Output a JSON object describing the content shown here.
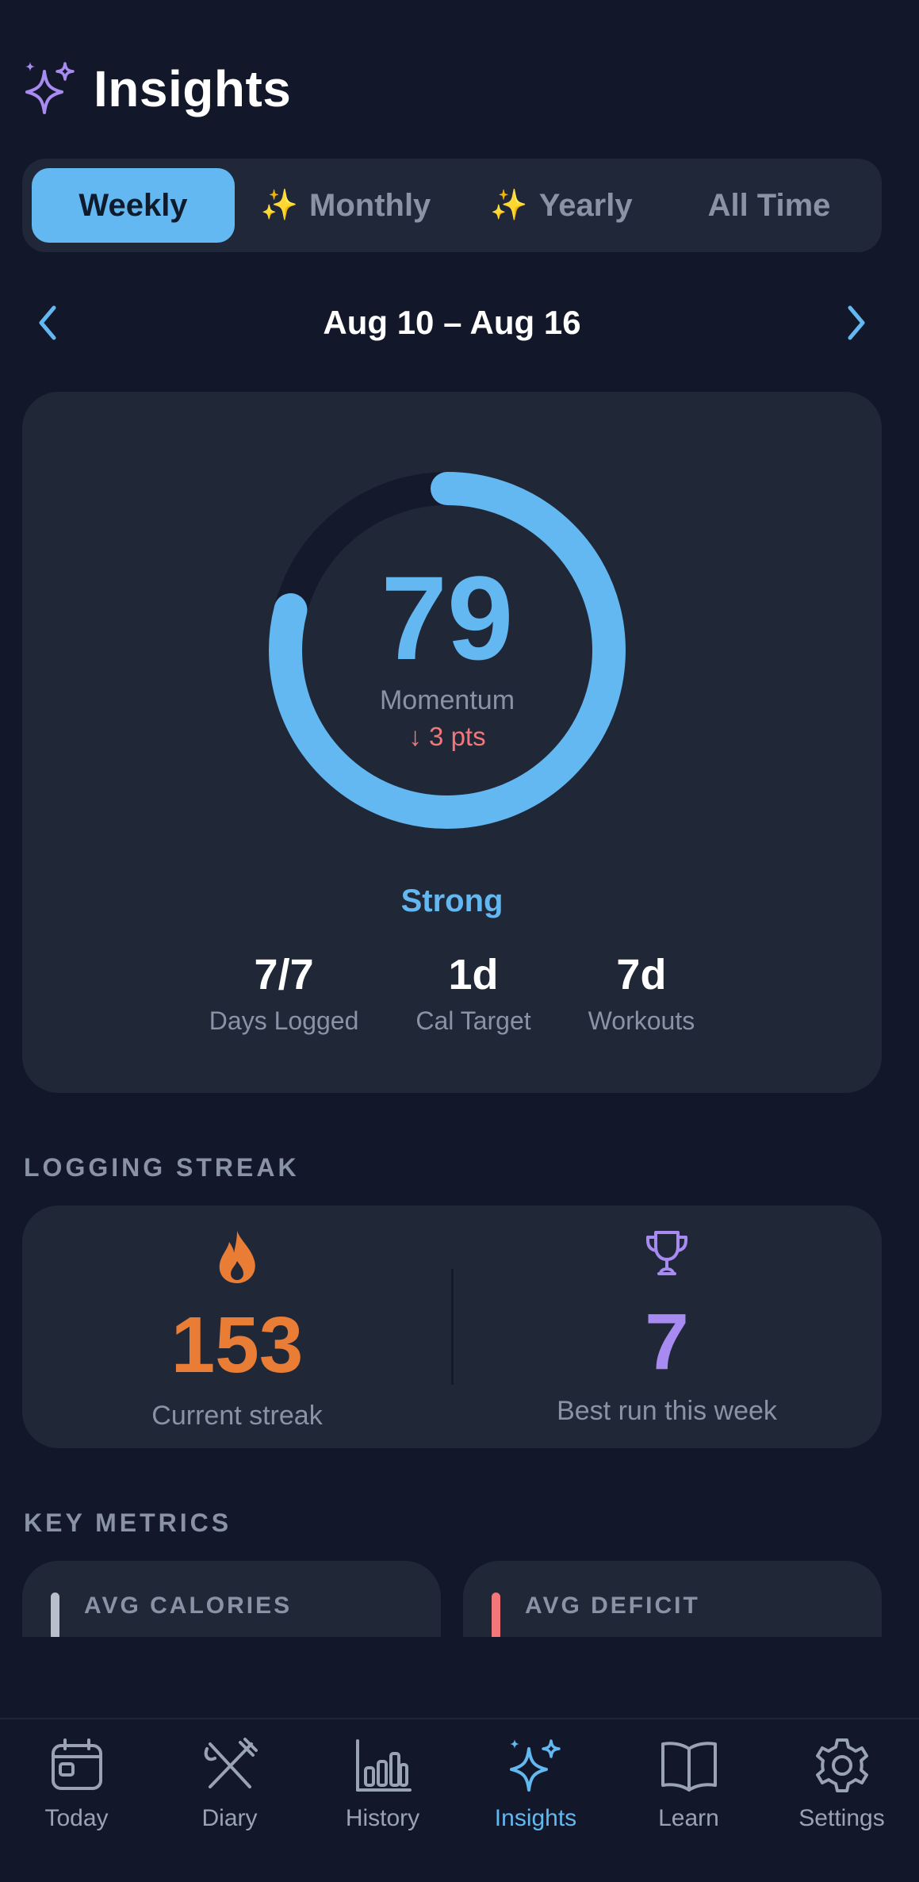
{
  "header": {
    "title": "Insights",
    "icon": "sparkles-icon"
  },
  "period_tabs": [
    {
      "label": "Weekly",
      "active": true,
      "premium": false
    },
    {
      "label": "Monthly",
      "active": false,
      "premium": true
    },
    {
      "label": "Yearly",
      "active": false,
      "premium": true
    },
    {
      "label": "All Time",
      "active": false,
      "premium": false
    }
  ],
  "premium_glyph": "✨",
  "date_nav": {
    "range": "Aug 10 – Aug 16",
    "prev_icon": "chevron-left-icon",
    "next_icon": "chevron-right-icon"
  },
  "momentum": {
    "score": "79",
    "score_value": 79,
    "score_max": 100,
    "label": "Momentum",
    "delta": "↓ 3 pts",
    "rating": "Strong",
    "stats": [
      {
        "value": "7/7",
        "label": "Days Logged"
      },
      {
        "value": "1d",
        "label": "Cal Target"
      },
      {
        "value": "7d",
        "label": "Workouts"
      }
    ]
  },
  "streak": {
    "section_label": "LOGGING STREAK",
    "current": {
      "value": "153",
      "label": "Current streak",
      "icon": "flame-icon"
    },
    "best": {
      "value": "7",
      "label": "Best run this week",
      "icon": "trophy-icon"
    }
  },
  "metrics": {
    "section_label": "KEY METRICS",
    "cards": [
      {
        "label": "AVG CALORIES",
        "accent": "#b9c0cc"
      },
      {
        "label": "AVG DEFICIT",
        "accent": "#f2777b"
      }
    ]
  },
  "tabbar": [
    {
      "label": "Today",
      "icon": "calendar-icon",
      "active": false
    },
    {
      "label": "Diary",
      "icon": "utensils-icon",
      "active": false
    },
    {
      "label": "History",
      "icon": "bar-chart-icon",
      "active": false
    },
    {
      "label": "Insights",
      "icon": "sparkles-icon",
      "active": true
    },
    {
      "label": "Learn",
      "icon": "book-icon",
      "active": false
    },
    {
      "label": "Settings",
      "icon": "gear-icon",
      "active": false
    }
  ],
  "colors": {
    "background": "#121829",
    "card": "#202838",
    "accent": "#63b8f1",
    "streak_orange": "#ea7d35",
    "best_purple": "#a78bf0",
    "negative": "#f2777b",
    "muted": "#8a93a6"
  }
}
